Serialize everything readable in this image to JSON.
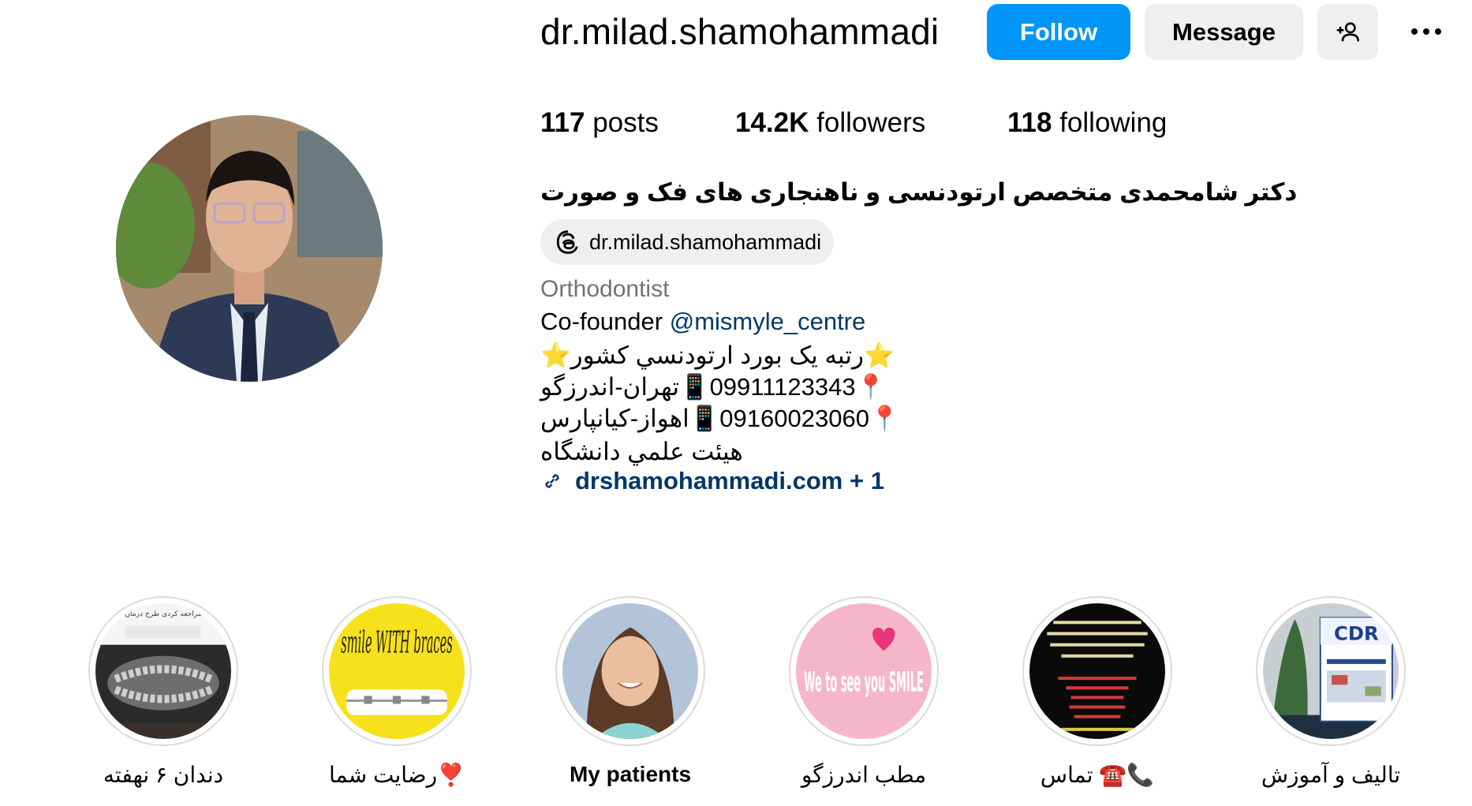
{
  "profile": {
    "username": "dr.milad.shamohammadi",
    "follow_label": "Follow",
    "message_label": "Message",
    "stats": {
      "posts_count": "117",
      "posts_label": "posts",
      "followers_count": "14.2K",
      "followers_label": "followers",
      "following_count": "118",
      "following_label": "following"
    },
    "full_name": "دکتر شامحمدی متخصص ارتودنسی و ناهنجاری های فک و صورت",
    "threads_handle": "dr.milad.shamohammadi",
    "category": "Orthodontist",
    "bio": {
      "cofounder_prefix": "Co-founder ",
      "cofounder_mention": "@mismyle_centre",
      "line_rank": "⭐رتبه یک بورد ارتودنسي کشور⭐",
      "line_tehran": "📍09911123343📱تهران-اندرزگو",
      "line_ahvaz": "📍09160023060📱اهواز-کیانپارس",
      "line_faculty": "هیئت علمي دانشگاه"
    },
    "website": "drshamohammadi.com + 1"
  },
  "highlights": [
    {
      "label": "دندان ۶ نهفته",
      "icon": "xray-thumbnail",
      "inner_text": "مراجعه کردی طرح درمان"
    },
    {
      "label": "رضایت شما❣️",
      "icon": "smile-with-braces-thumbnail",
      "inner_text": "smile WITH braces"
    },
    {
      "label": "My patients",
      "icon": "patient-photo-thumbnail"
    },
    {
      "label": "مطب اندرزگو",
      "icon": "we-love-to-see-you-smile-thumbnail",
      "inner_text": "We to see you SMILE"
    },
    {
      "label": "تماس ☎️📞",
      "icon": "contact-info-thumbnail"
    },
    {
      "label": "تالیف و آموزش",
      "icon": "cdr-book-thumbnail",
      "inner_text": "CDR"
    }
  ],
  "colors": {
    "follow_blue": "#0095f6",
    "link_blue": "#00376b",
    "secondary_gray": "#efefef",
    "muted_text": "#737373"
  }
}
